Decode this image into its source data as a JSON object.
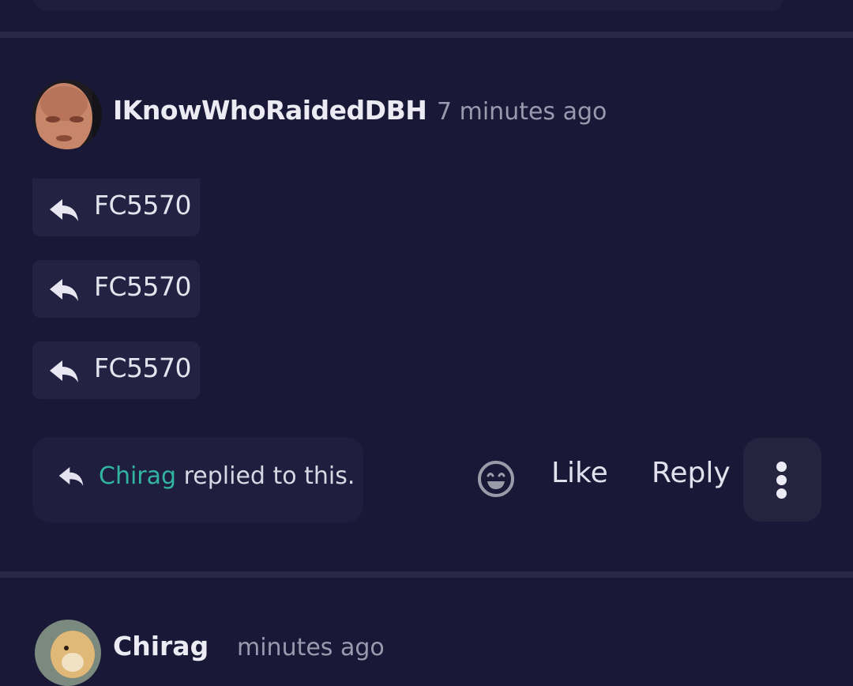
{
  "post": {
    "username": "IKnowWhoRaidedDBH",
    "timestamp": "7 minutes ago",
    "reply_chips": [
      {
        "label": "FC5570"
      },
      {
        "label": "FC5570"
      },
      {
        "label": "FC5570"
      }
    ],
    "replied_notice": {
      "user": "Chirag",
      "text": " replied to this."
    },
    "actions": {
      "emoji_icon": "smiley-icon",
      "like_label": "Like",
      "reply_label": "Reply",
      "more_icon": "vertical-ellipsis-icon"
    }
  },
  "next_post": {
    "username": "Chirag",
    "timestamp": "minutes ago"
  },
  "colors": {
    "background": "#191836",
    "accent_username": "#32b5a0",
    "chip_background": "#232243"
  }
}
